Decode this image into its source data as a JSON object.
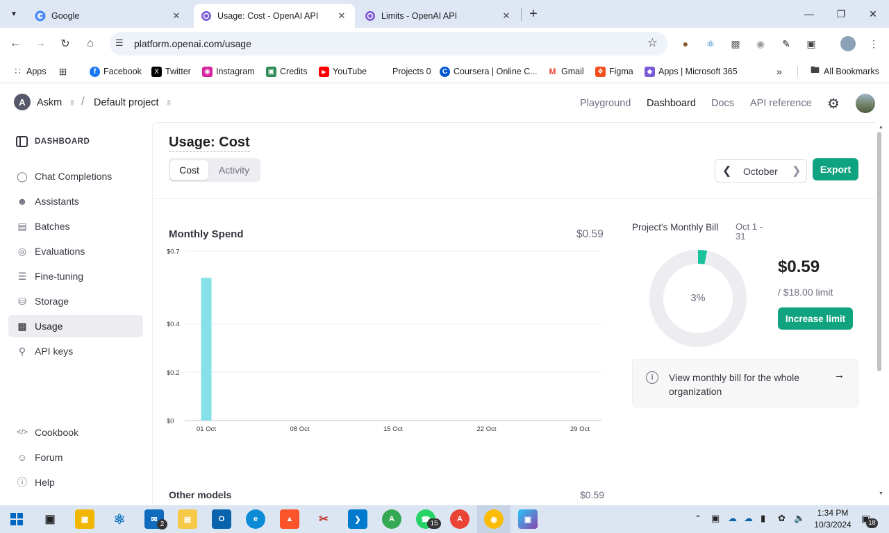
{
  "browser": {
    "tabs": [
      {
        "title": "Google",
        "icon": "google-icon"
      },
      {
        "title": "Usage: Cost - OpenAI API",
        "icon": "openai-icon"
      },
      {
        "title": "Limits - OpenAI API",
        "icon": "openai-icon"
      }
    ],
    "new_tab": "+",
    "url": "platform.openai.com/usage",
    "bookmarks": [
      {
        "label": "Apps",
        "icon": "apps-grid-icon"
      },
      {
        "label": "",
        "icon": "grid-icon"
      },
      {
        "label": "Facebook",
        "icon": "facebook-icon"
      },
      {
        "label": "Twitter",
        "icon": "twitter-icon"
      },
      {
        "label": "Instagram",
        "icon": "instagram-icon"
      },
      {
        "label": "Credits",
        "icon": "credits-icon"
      },
      {
        "label": "YouTube",
        "icon": "youtube-icon"
      },
      {
        "label": "Projects 0",
        "icon": ""
      },
      {
        "label": "Coursera | Online C...",
        "icon": "coursera-icon"
      },
      {
        "label": "Gmail",
        "icon": "gmail-icon"
      },
      {
        "label": "Figma",
        "icon": "figma-icon"
      },
      {
        "label": "Apps | Microsoft 365",
        "icon": "m365-icon"
      }
    ],
    "all_bookmarks": "All Bookmarks"
  },
  "header": {
    "org_initial": "A",
    "org_name": "Askm",
    "project": "Default project",
    "links": [
      "Playground",
      "Dashboard",
      "Docs",
      "API reference"
    ]
  },
  "sidebar": {
    "section": "DASHBOARD",
    "items": [
      {
        "label": "Chat Completions",
        "icon": "chat-icon"
      },
      {
        "label": "Assistants",
        "icon": "assistant-icon"
      },
      {
        "label": "Batches",
        "icon": "batches-icon"
      },
      {
        "label": "Evaluations",
        "icon": "evaluations-icon"
      },
      {
        "label": "Fine-tuning",
        "icon": "fine-tuning-icon"
      },
      {
        "label": "Storage",
        "icon": "storage-icon"
      },
      {
        "label": "Usage",
        "icon": "usage-icon"
      },
      {
        "label": "API keys",
        "icon": "key-icon"
      }
    ],
    "footer": [
      {
        "label": "Cookbook",
        "icon": "code-icon"
      },
      {
        "label": "Forum",
        "icon": "forum-icon"
      },
      {
        "label": "Help",
        "icon": "help-icon"
      }
    ]
  },
  "main": {
    "title": "Usage: Cost",
    "tabs": [
      "Cost",
      "Activity"
    ],
    "month": "October",
    "export": "Export",
    "monthly_spend_title": "Monthly Spend",
    "monthly_spend_total": "$0.59",
    "other_models_label": "Other models",
    "other_models_value": "$0.59"
  },
  "bill": {
    "title": "Project's Monthly Bill",
    "range_line1": "Oct 1 -",
    "range_line2": "31",
    "percent_label": "3%",
    "percent_value": 0.03,
    "amount": "$0.59",
    "limit": "/ $18.00 limit",
    "increase": "Increase limit",
    "view_line1": "View monthly bill for the whole",
    "view_line2": "organization"
  },
  "chart_data": {
    "type": "bar",
    "x": [
      "01 Oct",
      "02 Oct",
      "03 Oct",
      "04 Oct",
      "05 Oct",
      "06 Oct",
      "07 Oct",
      "08 Oct",
      "09 Oct",
      "10 Oct",
      "11 Oct",
      "12 Oct",
      "13 Oct",
      "14 Oct",
      "15 Oct",
      "16 Oct",
      "17 Oct",
      "18 Oct",
      "19 Oct",
      "20 Oct",
      "21 Oct",
      "22 Oct",
      "23 Oct",
      "24 Oct",
      "25 Oct",
      "26 Oct",
      "27 Oct",
      "28 Oct",
      "29 Oct",
      "30 Oct",
      "31 Oct"
    ],
    "values": [
      0.59,
      0,
      0,
      0,
      0,
      0,
      0,
      0,
      0,
      0,
      0,
      0,
      0,
      0,
      0,
      0,
      0,
      0,
      0,
      0,
      0,
      0,
      0,
      0,
      0,
      0,
      0,
      0,
      0,
      0,
      0
    ],
    "x_tick_labels": [
      "01 Oct",
      "08 Oct",
      "15 Oct",
      "22 Oct",
      "29 Oct"
    ],
    "y_ticks": [
      0,
      0.2,
      0.4,
      0.7
    ],
    "y_tick_labels": [
      "$0",
      "$0.2",
      "$0.4",
      "$0.7"
    ],
    "ylim": [
      0,
      0.7
    ],
    "bar_color": "#85e0e8",
    "grid": true
  },
  "taskbar": {
    "time": "1:34 PM",
    "date": "10/3/2024",
    "mail_badge": "2",
    "whatsapp_badge": "15",
    "notif_badge": "18"
  },
  "colors": {
    "accent": "#10a37f",
    "gauge_track": "#ececf1",
    "gauge_fill": "#19c39c"
  }
}
